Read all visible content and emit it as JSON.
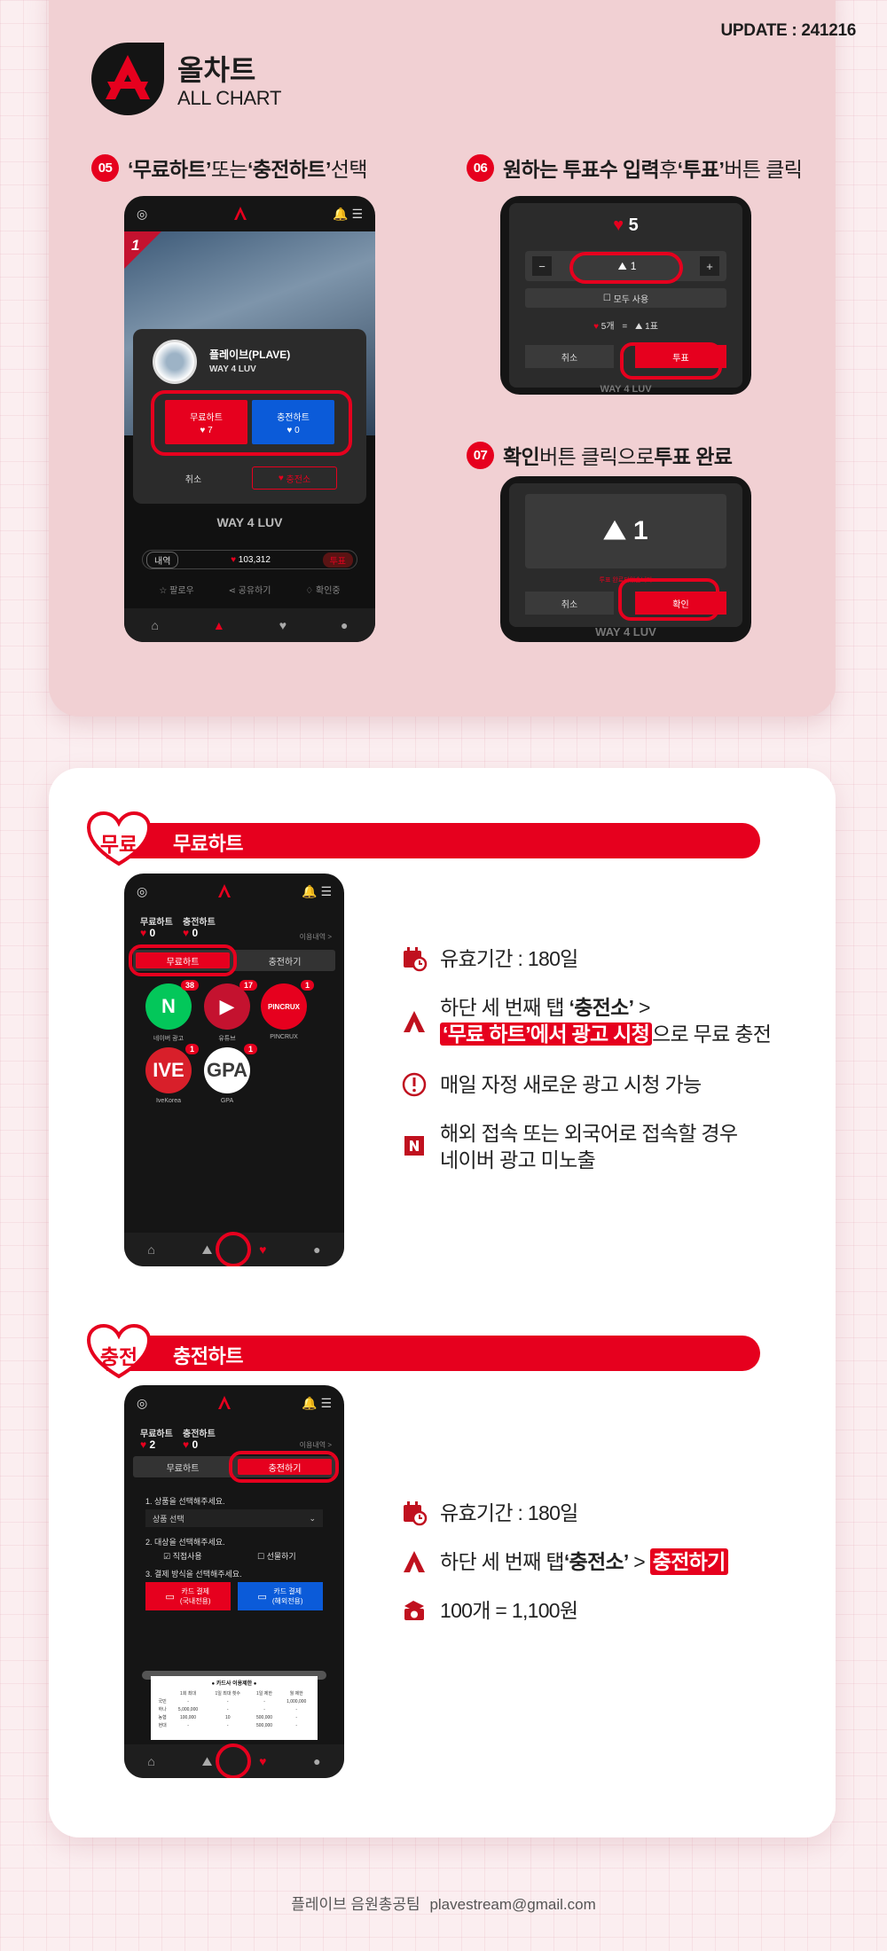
{
  "header": {
    "update": "UPDATE : 241216",
    "brand_ko": "올차트",
    "brand_en": "ALL CHART"
  },
  "steps": {
    "s05": {
      "num": "05",
      "p1": "‘무료하트’",
      "p2": " 또는 ",
      "p3": "‘충전하트’",
      "p4": " 선택"
    },
    "s06": {
      "num": "06",
      "p1": "원하는 투표수 입력",
      "p2": " 후 ",
      "p3": "‘투표’",
      "p4": " 버튼 클릭"
    },
    "s07": {
      "num": "07",
      "p1": "확인",
      "p2": " 버튼 클릭으로 ",
      "p3": "투표 완료"
    }
  },
  "phone05": {
    "artist": "플레이브(PLAVE)",
    "song": "WAY 4 LUV",
    "free_label": "무료하트",
    "free_count": "♥ 7",
    "paid_label": "충전하트",
    "paid_count": "♥ 0",
    "cancel": "취소",
    "charge": "충전소",
    "title": "WAY 4 LUV",
    "history": "내역",
    "total": "103,312",
    "vote": "투표",
    "follow": "팔로우",
    "share": "공유하기",
    "confirm": "확인중",
    "rank": "1"
  },
  "phone06": {
    "hearts": "5",
    "minus": "−",
    "plus": "+",
    "votes_input": "1",
    "use_all": "모두 사용",
    "rate_hearts": "5개",
    "rate_eq": "=",
    "rate_votes": "1표",
    "cancel": "취소",
    "vote": "투표",
    "song": "WAY 4 LUV"
  },
  "phone07": {
    "votes": "1",
    "notice": "투표 완료되었습니다",
    "cancel": "취소",
    "confirm": "확인",
    "song": "WAY 4 LUV"
  },
  "free_section": {
    "badge": "무료",
    "title": "무료하트",
    "phone": {
      "free_label": "무료하트",
      "free_count": "0",
      "paid_label": "충전하트",
      "paid_count": "0",
      "history": "이용내역 >",
      "tab_free": "무료하트",
      "tab_charge": "충전하기",
      "apps": [
        {
          "name": "네이버 광고",
          "glyph": "N",
          "count": "38",
          "color": "#03c75a"
        },
        {
          "name": "유튜브",
          "glyph": "▶",
          "count": "17",
          "color": "#c4122f"
        },
        {
          "name": "PINCRUX",
          "glyph": "PINCRUX",
          "count": "1",
          "color": "#e6001e"
        },
        {
          "name": "IveKorea",
          "glyph": "IVE",
          "count": "1",
          "color": "#d81f2a"
        },
        {
          "name": "GPA",
          "glyph": "GPA",
          "count": "1",
          "color": "#ffffff"
        }
      ]
    },
    "info": {
      "validity": "유효기간 : 180일",
      "tab_p1": "하단 세 번째 탭 ",
      "tab_p2": "‘충전소’",
      "tab_p3": " >",
      "tab_l2_hl1": "‘무료 하트’에서 ",
      "tab_l2_hl2": "광고 시청",
      "tab_l2_rest": "으로 무료 충전",
      "midnight": "매일 자정 새로운 광고 시청 가능",
      "naver_l1": "해외 접속 또는 외국어로 접속할 경우",
      "naver_l2": "네이버 광고 미노출"
    }
  },
  "paid_section": {
    "badge": "충전",
    "title": "충전하트",
    "phone": {
      "free_label": "무료하트",
      "free_count": "2",
      "paid_label": "충전하트",
      "paid_count": "0",
      "history": "이용내역 >",
      "tab_free": "무료하트",
      "tab_charge": "충전하기",
      "step1": "1. 상품을 선택해주세요.",
      "select": "상품 선택",
      "step2": "2. 대상을 선택해주세요.",
      "self": "직접사용",
      "gift": "선물하기",
      "step3": "3. 결제 방식을 선택해주세요.",
      "pay_domestic_1": "카드 결제",
      "pay_domestic_2": "(국내전용)",
      "pay_overseas_1": "카드 결제",
      "pay_overseas_2": "(해외전용)",
      "limit_title": "● 카드사 이용제한 ●",
      "limit_head": [
        "",
        "1회 최대",
        "1일 최대 횟수",
        "1일 제한",
        "월 제한"
      ],
      "limit_rows": [
        [
          "국민",
          "-",
          "-",
          "-",
          "1,000,000"
        ],
        [
          "하나",
          "5,000,000",
          "-",
          "-",
          "-"
        ],
        [
          "농협",
          "100,000",
          "10",
          "500,000",
          "-"
        ],
        [
          "현대",
          "-",
          "-",
          "500,000",
          "-"
        ]
      ]
    },
    "info": {
      "validity": "유효기간 : 180일",
      "tab_p1": "하단 세 번째 탭 ",
      "tab_p2": "‘충전소’",
      "tab_p3": " > ",
      "tab_hl": "충전하기",
      "price": "100개 = 1,100원"
    }
  },
  "footer": {
    "team": "플레이브 음원총공팀",
    "email": "plavestream@gmail.com"
  },
  "colors": {
    "accent": "#e6001e",
    "blue": "#0b5bd9",
    "card_top": "#f1d0d3"
  }
}
